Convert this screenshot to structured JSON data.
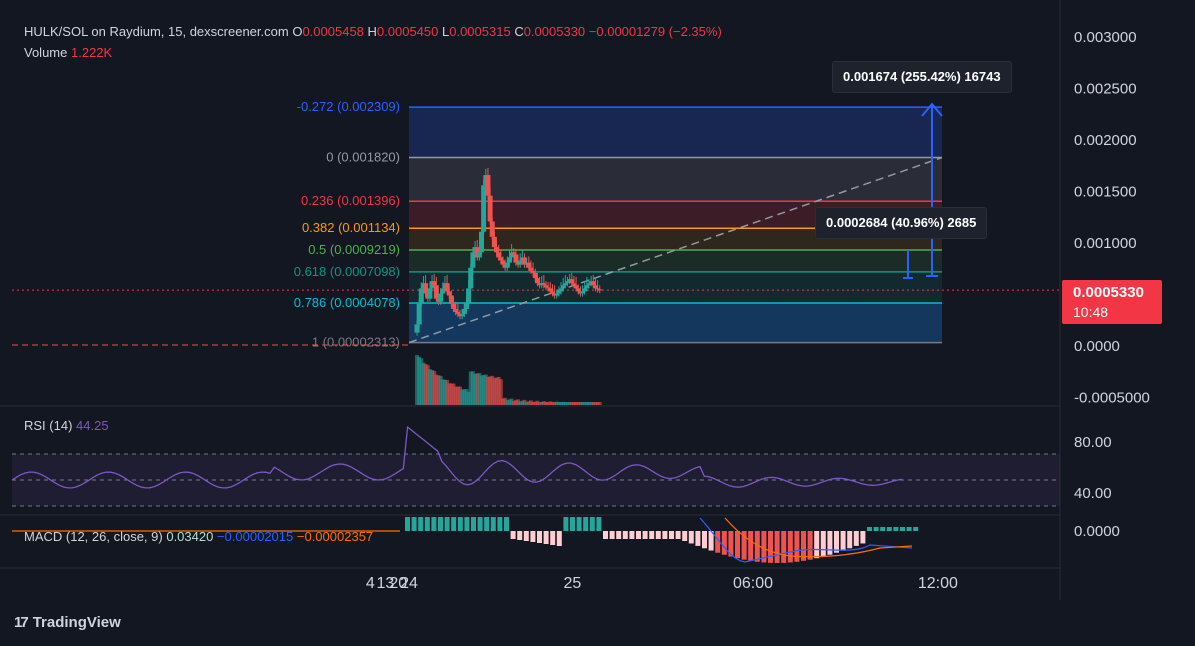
{
  "header": {
    "symbol": "HULK/SOL on Raydium, 15, dexscreener.com",
    "o_label": "O",
    "o_value": "0.0005458",
    "h_label": "H",
    "h_value": "0.0005450",
    "l_label": "L",
    "l_value": "0.0005315",
    "c_label": "C",
    "c_value": "0.0005330",
    "change": "−0.00001279 (−2.35%)",
    "volume_label": "Volume",
    "volume_value": "1.222K"
  },
  "price_tag": {
    "price": "0.0005330",
    "countdown": "10:48"
  },
  "measures": {
    "big": "0.001674 (255.42%) 16743",
    "small": "0.0002684 (40.96%) 2685"
  },
  "rsi": {
    "label": "RSI (14)",
    "value": "44.25"
  },
  "macd": {
    "label": "MACD (12, 26, close, 9)",
    "v1": "0.03420",
    "v2": "−0.00002015",
    "v3": "−0.00002357"
  },
  "branding": {
    "name": "TradingView"
  },
  "colors": {
    "bg": "#131722",
    "up": "#26a69a",
    "down": "#ef5350",
    "grid": "#1f2330"
  },
  "chart_data": {
    "type": "candlestick",
    "price_axis_ticks": [
      "0.003000",
      "0.002500",
      "0.002000",
      "0.001500",
      "0.001000",
      "0.0000",
      "-0.0005000"
    ],
    "price_axis_values": [
      0.003,
      0.0025,
      0.002,
      0.0015,
      0.001,
      0,
      -0.0005
    ],
    "rsi_axis_ticks": [
      "80.00",
      "40.00"
    ],
    "macd_axis_ticks": [
      "0.0000"
    ],
    "time_axis": [
      {
        "label": "4",
        "i": -18
      },
      {
        "label": "13",
        "i": -11
      },
      {
        "label": "20",
        "i": -5
      },
      {
        "label": "24",
        "i": 0
      },
      {
        "label": "25",
        "i": 76
      },
      {
        "label": "06:00",
        "i": 160
      },
      {
        "label": "12:00",
        "i": 246
      }
    ],
    "fib_levels": [
      {
        "label": "-0.272 (0.002309)",
        "price": 0.002309,
        "color": "#2962ff"
      },
      {
        "label": "0 (0.001820)",
        "price": 0.00182,
        "color": "#9598a1"
      },
      {
        "label": "0.236 (0.001396)",
        "price": 0.001396,
        "color": "#f23645"
      },
      {
        "label": "0.382 (0.001134)",
        "price": 0.001134,
        "color": "#ff9800"
      },
      {
        "label": "0.5 (0.0009219)",
        "price": 0.0009219,
        "color": "#4caf50"
      },
      {
        "label": "0.618 (0.0007098)",
        "price": 0.0007098,
        "color": "#089981"
      },
      {
        "label": "0.786 (0.0004078)",
        "price": 0.0004078,
        "color": "#00bcd4"
      },
      {
        "label": "1 (0.00002313)",
        "price": 2.313e-05,
        "color": "#787b86"
      }
    ],
    "close_series": [
      0.0002,
      0.0004,
      0.00055,
      0.0006,
      0.0005,
      0.00045,
      0.00055,
      0.00062,
      0.00058,
      0.00045,
      0.00042,
      0.0005,
      0.00055,
      0.0006,
      0.00052,
      0.00048,
      0.0004,
      0.00035,
      0.00032,
      0.0003,
      0.00028,
      0.0003,
      0.00035,
      0.0004,
      0.00055,
      0.00075,
      0.0009,
      0.00095,
      0.00085,
      0.0009,
      0.0011,
      0.00155,
      0.00165,
      0.00145,
      0.0012,
      0.00105,
      0.00095,
      0.0009,
      0.00085,
      0.00082,
      0.00078,
      0.00075,
      0.0008,
      0.00085,
      0.0009,
      0.00088,
      0.0008,
      0.00078,
      0.00082,
      0.00085,
      0.00078,
      0.0008,
      0.00075,
      0.00072,
      0.0007,
      0.00065,
      0.0006,
      0.00058,
      0.0006,
      0.00058,
      0.00056,
      0.00055,
      0.00052,
      0.0005,
      0.00048,
      0.0005,
      0.00052,
      0.00055,
      0.00058,
      0.0006,
      0.00062,
      0.00064,
      0.0006,
      0.00058,
      0.00055,
      0.00052,
      0.0005,
      0.00052,
      0.00055,
      0.00058,
      0.0006,
      0.00062,
      0.00058,
      0.00055,
      0.00054,
      0.000533
    ]
  }
}
